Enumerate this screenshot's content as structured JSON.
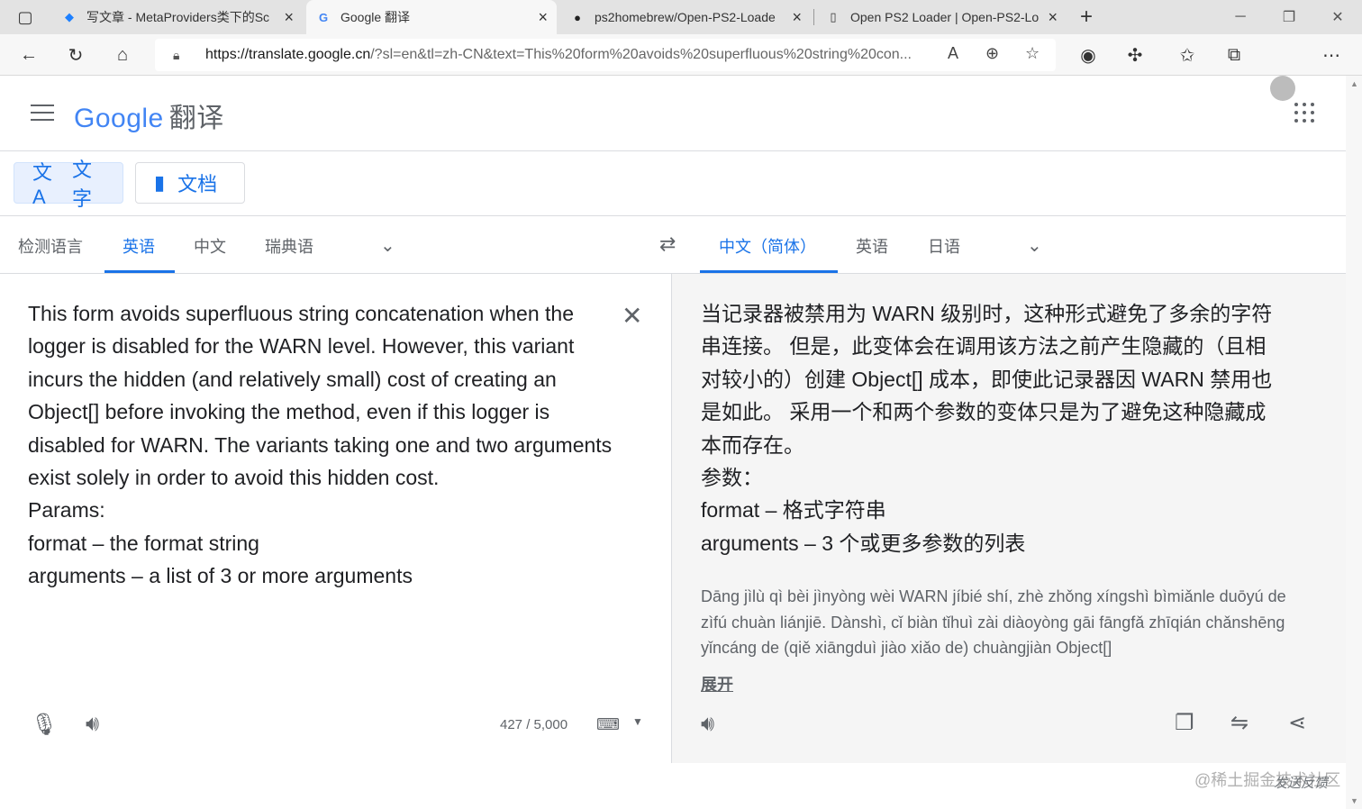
{
  "browser": {
    "tabs": [
      {
        "title": "写文章 - MetaProviders类下的Sc",
        "favicon": "juejin-icon"
      },
      {
        "title": "Google 翻译",
        "favicon": "google-translate-icon"
      },
      {
        "title": "ps2homebrew/Open-PS2-Loade",
        "favicon": "github-icon"
      },
      {
        "title": "Open PS2 Loader | Open-PS2-Lo",
        "favicon": "document-icon"
      }
    ],
    "url_host": "https://translate.google.cn",
    "url_rest": "/?sl=en&tl=zh-CN&text=This%20form%20avoids%20superfluous%20string%20con..."
  },
  "header": {
    "logo_google": "Google",
    "logo_product": "翻译"
  },
  "modes": {
    "text_label": "文字",
    "doc_label": "文档"
  },
  "source_langs": {
    "detect": "检测语言",
    "english": "英语",
    "chinese": "中文",
    "swedish": "瑞典语"
  },
  "target_langs": {
    "chinese_simplified": "中文（简体）",
    "english": "英语",
    "japanese": "日语"
  },
  "source": {
    "text": "This form avoids superfluous string concatenation when the logger is disabled for the WARN level. However, this variant incurs the hidden (and relatively small) cost of creating an Object[] before invoking the method, even if this logger is disabled for WARN. The variants taking one and two arguments exist solely in order to avoid this hidden cost.\nParams:\nformat – the format string\narguments – a list of 3 or more arguments",
    "char_count": "427 / 5,000"
  },
  "target": {
    "text": "当记录器被禁用为 WARN 级别时，这种形式避免了多余的字符串连接。 但是，此变体会在调用该方法之前产生隐藏的（且相对较小的）创建 Object[] 成本，即使此记录器因 WARN 禁用也是如此。 采用一个和两个参数的变体只是为了避免这种隐藏成本而存在。\n参数：\nformat – 格式字符串\narguments – 3 个或更多参数的列表",
    "pinyin": "Dāng jìlù qì bèi jìnyòng wèi WARN jíbié shí, zhè zhǒng xíngshì bìmiǎnle duōyú de zìfú chuàn liánjiē. Dànshì, cǐ biàn tǐhuì zài diàoyòng gāi fāngfǎ zhīqián chǎnshēng yǐncáng de (qiě xiāngduì jiào xiǎo de) chuàngjiàn Object[]",
    "expand": "展开"
  },
  "footer": {
    "feedback": "发送反馈",
    "watermark": "@稀土掘金技术社区"
  },
  "colors": {
    "accent": "#1a73e8",
    "target_bg": "#f5f5f5"
  }
}
